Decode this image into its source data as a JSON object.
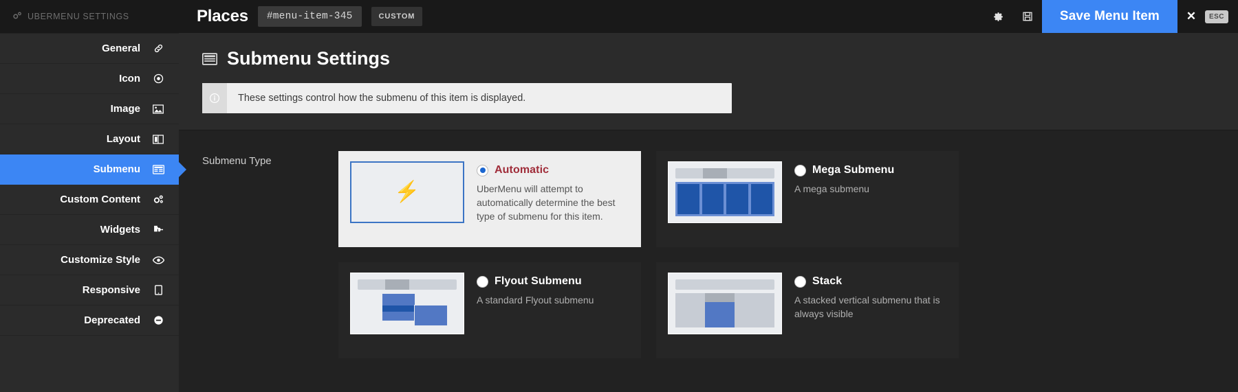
{
  "header": {
    "brand": "UBERMENU SETTINGS",
    "brand_icon": "cogs-icon",
    "title": "Places",
    "slug": "#menu-item-345",
    "item_type": "CUSTOM",
    "gear_icon": "gear-icon",
    "save_icon": "floppy-disk-icon",
    "save_label": "Save Menu Item",
    "close_icon": "close-icon",
    "esc_label": "ESC",
    "accent": "#3c86f4"
  },
  "sidebar": {
    "items": [
      {
        "label": "General",
        "icon": "link-icon",
        "active": false
      },
      {
        "label": "Icon",
        "icon": "target-icon",
        "active": false
      },
      {
        "label": "Image",
        "icon": "image-icon",
        "active": false
      },
      {
        "label": "Layout",
        "icon": "columns-icon",
        "active": false
      },
      {
        "label": "Submenu",
        "icon": "submenu-icon",
        "active": true
      },
      {
        "label": "Custom Content",
        "icon": "cogs-icon",
        "active": false
      },
      {
        "label": "Widgets",
        "icon": "puzzle-icon",
        "active": false
      },
      {
        "label": "Customize Style",
        "icon": "eye-icon",
        "active": false
      },
      {
        "label": "Responsive",
        "icon": "mobile-icon",
        "active": false
      },
      {
        "label": "Deprecated",
        "icon": "minus-circle-icon",
        "active": false
      }
    ]
  },
  "main": {
    "page_title": "Submenu Settings",
    "page_title_icon": "submenu-icon",
    "notice_icon": "info-icon",
    "notice_text": "These settings control how the submenu of this item is displayed.",
    "setting_label": "Submenu Type",
    "options": [
      {
        "title": "Automatic",
        "description": "UberMenu will attempt to automatically determine the best type of submenu for this item.",
        "selected": true,
        "thumb": "bolt",
        "thumb_icon": "lightning-bolt-icon"
      },
      {
        "title": "Mega Submenu",
        "description": "A mega submenu",
        "selected": false,
        "thumb": "mega",
        "thumb_icon": "mega-submenu-preview-icon"
      },
      {
        "title": "Flyout Submenu",
        "description": "A standard Flyout submenu",
        "selected": false,
        "thumb": "flyout",
        "thumb_icon": "flyout-submenu-preview-icon"
      },
      {
        "title": "Stack",
        "description": "A stacked vertical submenu that is always visible",
        "selected": false,
        "thumb": "stack",
        "thumb_icon": "stack-submenu-preview-icon"
      }
    ]
  }
}
